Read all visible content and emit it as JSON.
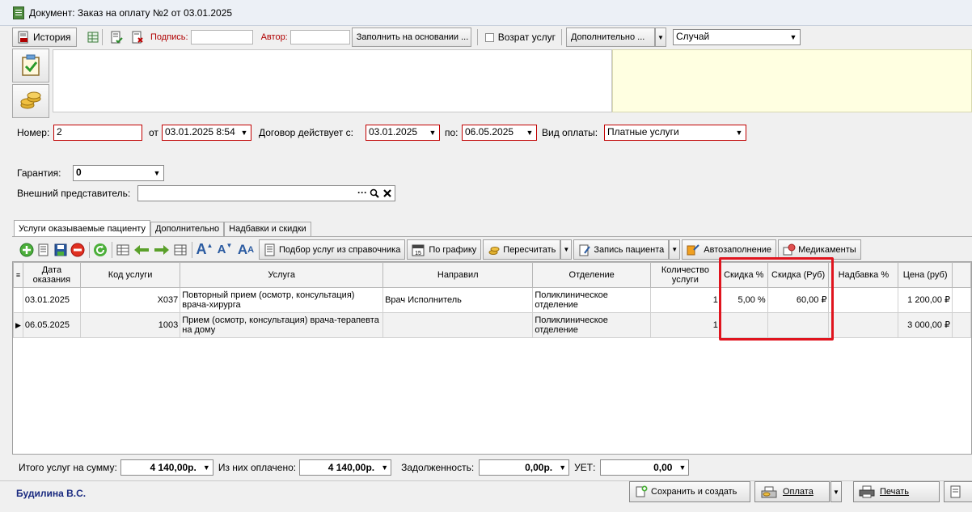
{
  "window": {
    "title": "Документ: Заказ на оплату №2 от 03.01.2025"
  },
  "toolbar": {
    "history_label": "История",
    "signature_label": "Подпись:",
    "signature_value": "",
    "author_label": "Автор:",
    "author_value": "",
    "fill_based_label": "Заполнить на основании ...",
    "return_services_label": "Возрат услуг",
    "additional_label": "Дополнительно ...",
    "case_value": "Случай"
  },
  "form": {
    "number_label": "Номер:",
    "number_value": "2",
    "from_label": "от",
    "from_value": "03.01.2025 8:54",
    "contract_label": "Договор действует с:",
    "contract_from": "03.01.2025",
    "to_label": "по:",
    "contract_to": "06.05.2025",
    "payment_type_label": "Вид оплаты:",
    "payment_type_value": "Платные услуги",
    "guarantee_label": "Гарантия:",
    "guarantee_value": "0",
    "external_rep_label": "Внешний представитель:",
    "external_rep_value": ""
  },
  "tabs": [
    {
      "label": "Услуги оказываемые пациенту"
    },
    {
      "label": "Дополнительно"
    },
    {
      "label": "Надбавки и скидки"
    }
  ],
  "toolbar2": {
    "select_services_label": "Подбор услуг из справочника",
    "calendar_day": "15",
    "by_schedule_label": "По графику",
    "recalc_label": "Пересчитать",
    "patient_record_label": "Запись пациента",
    "autofill_label": "Автозаполнение",
    "medications_label": "Медикаменты"
  },
  "grid": {
    "columns": [
      "Дата оказания",
      "Код услуги",
      "Услуга",
      "Направил",
      "Отделение",
      "Количество услуги",
      "Скидка %",
      "Скидка (Руб)",
      "Надбавка %",
      "Цена (руб)"
    ],
    "rows": [
      {
        "date": "03.01.2025",
        "code": "X037",
        "service": " Повторный прием (осмотр, консультация) врача-хирурга",
        "referrer": "Врач Исполнитель",
        "department": "Поликлиническое отделение",
        "qty": "1",
        "discount_pct": "5,00 %",
        "discount_rub": "60,00 ₽",
        "markup": "",
        "price": "1 200,00 ₽"
      },
      {
        "date": "06.05.2025",
        "code": "1003",
        "service": "Прием (осмотр, консультация) врача-терапевта на дому",
        "referrer": "",
        "department": "Поликлиническое отделение",
        "qty": "1",
        "discount_pct": "",
        "discount_rub": "",
        "markup": "",
        "price": "3 000,00 ₽"
      }
    ]
  },
  "totals": {
    "total_label": "Итого услуг на сумму:",
    "total_value": "4 140,00р.",
    "paid_label": "Из них оплачено:",
    "paid_value": "4 140,00р.",
    "debt_label": "Задолженность:",
    "debt_value": "0,00р.",
    "uet_label": "УЕТ:",
    "uet_value": "0,00"
  },
  "footer": {
    "user": "Будилина В.С.",
    "save_create_label": "Сохранить и создать",
    "payment_label": "Оплата",
    "print_label": "Печать"
  }
}
